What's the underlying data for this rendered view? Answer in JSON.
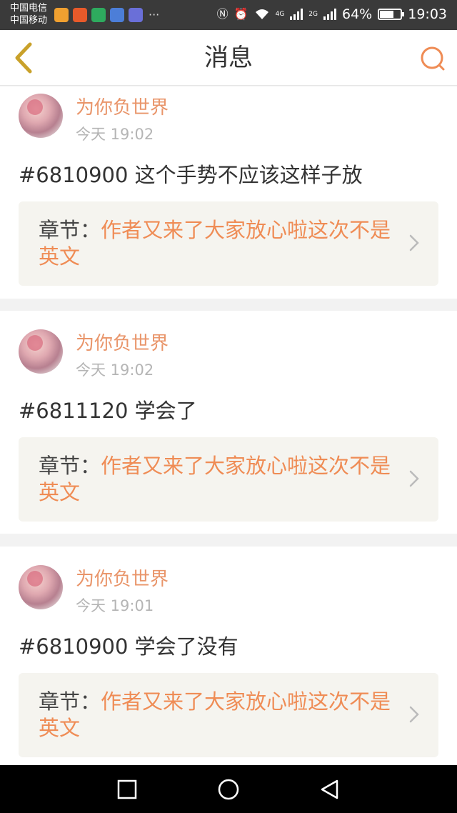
{
  "status_bar": {
    "carrier_1": "中国电信",
    "carrier_2": "中国移动",
    "more_indicator": "···",
    "network_1": "4G",
    "network_2": "2G",
    "battery_percent": "64%",
    "battery_level": 0.64,
    "time": "19:03"
  },
  "header": {
    "title": "消息",
    "back_icon": "chevron-left-icon",
    "search_icon": "search-icon"
  },
  "colors": {
    "accent": "#ef8c55",
    "username": "#e9956a",
    "chapter_bg": "#f5f4ef",
    "page_bg": "#f2f2f2"
  },
  "messages": [
    {
      "username": "为你负世界",
      "time": "今天 19:02",
      "content": "#6810900 这个手势不应该这样子放",
      "chapter_label": "章节：",
      "chapter_title": "作者又来了大家放心啦这次不是英文"
    },
    {
      "username": "为你负世界",
      "time": "今天 19:02",
      "content": "#6811120 学会了",
      "chapter_label": "章节：",
      "chapter_title": "作者又来了大家放心啦这次不是英文"
    },
    {
      "username": "为你负世界",
      "time": "今天 19:01",
      "content": "#6810900 学会了没有",
      "chapter_label": "章节：",
      "chapter_title": "作者又来了大家放心啦这次不是英文"
    }
  ],
  "nav_bar": {
    "recent_icon": "square-recent-apps-icon",
    "home_icon": "circle-home-icon",
    "back_icon": "triangle-back-icon"
  }
}
